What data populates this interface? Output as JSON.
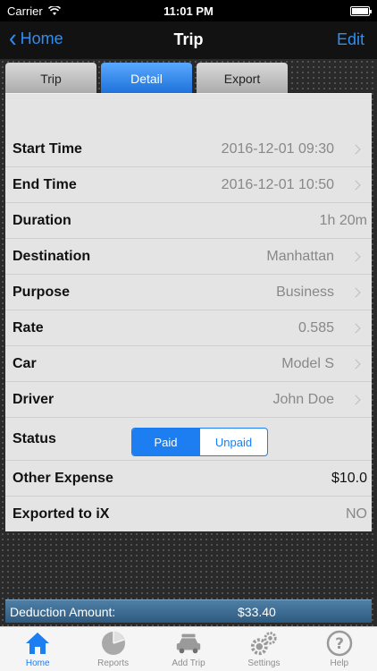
{
  "status_bar": {
    "carrier": "Carrier",
    "time": "11:01 PM"
  },
  "nav": {
    "back_label": "Home",
    "title": "Trip",
    "edit_label": "Edit"
  },
  "tabs": [
    {
      "label": "Trip",
      "active": false
    },
    {
      "label": "Detail",
      "active": true
    },
    {
      "label": "Export",
      "active": false
    }
  ],
  "rows": [
    {
      "label": "Start Time",
      "value": "2016-12-01 09:30",
      "chevron": true
    },
    {
      "label": "End Time",
      "value": "2016-12-01 10:50",
      "chevron": true
    },
    {
      "label": "Duration",
      "value": "1h 20m",
      "chevron": false
    },
    {
      "label": "Destination",
      "value": "Manhattan",
      "chevron": true
    },
    {
      "label": "Purpose",
      "value": "Business",
      "chevron": true
    },
    {
      "label": "Rate",
      "value": "0.585",
      "chevron": true
    },
    {
      "label": "Car",
      "value": "Model S",
      "chevron": true
    },
    {
      "label": "Driver",
      "value": "John Doe",
      "chevron": true
    }
  ],
  "status": {
    "label": "Status",
    "options": [
      "Paid",
      "Unpaid"
    ],
    "selected": "Paid"
  },
  "other_expense": {
    "label": "Other Expense",
    "value": "$10.0"
  },
  "exported": {
    "label": "Exported to iX",
    "value": "NO"
  },
  "deduction": {
    "label": "Deduction Amount:",
    "value": "$33.40"
  },
  "tab_bar": [
    {
      "label": "Home",
      "icon": "home-icon",
      "active": true
    },
    {
      "label": "Reports",
      "icon": "pie-chart-icon",
      "active": false
    },
    {
      "label": "Add Trip",
      "icon": "car-icon",
      "active": false
    },
    {
      "label": "Settings",
      "icon": "gears-icon",
      "active": false
    },
    {
      "label": "Help",
      "icon": "help-icon",
      "active": false
    }
  ],
  "colors": {
    "accent": "#1c7ef0",
    "nav_bg": "#121212",
    "panel_bg": "#e4e4e4"
  }
}
